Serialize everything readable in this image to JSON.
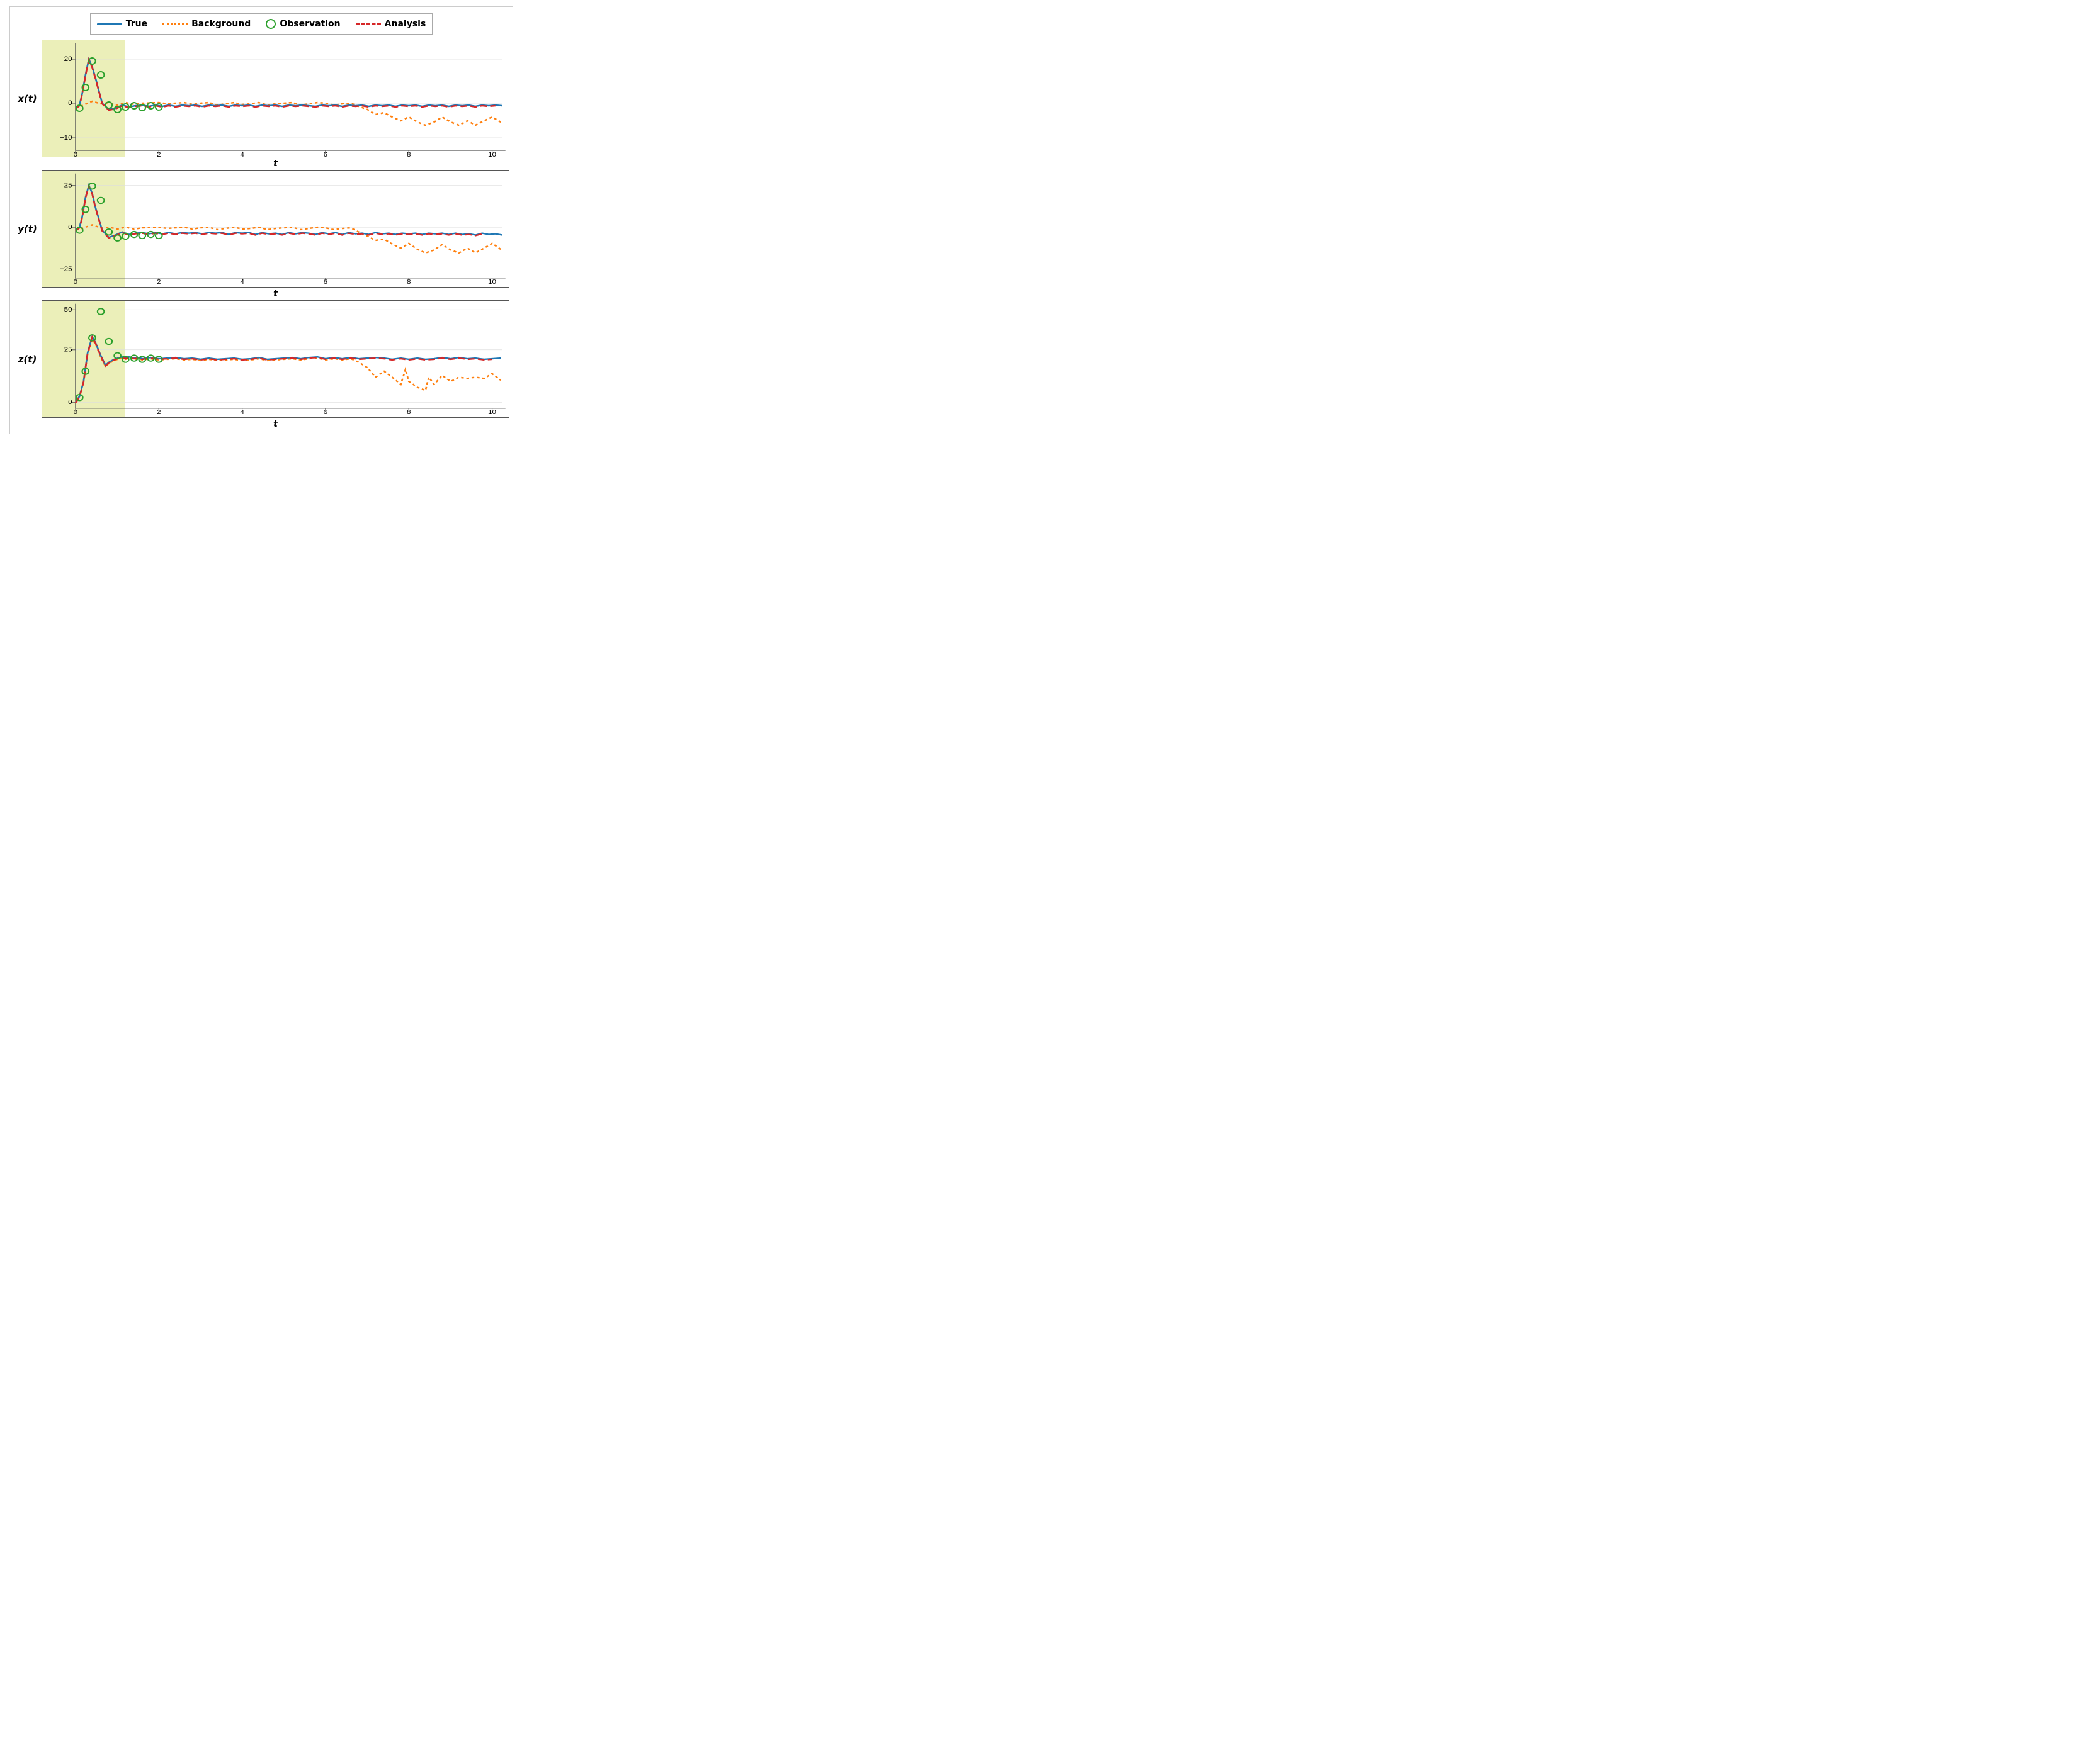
{
  "legend": {
    "items": [
      {
        "label": "True",
        "type": "solid-blue"
      },
      {
        "label": "Background",
        "type": "dotted-orange"
      },
      {
        "label": "Observation",
        "type": "circle-green"
      },
      {
        "label": "Analysis",
        "type": "dashed-red"
      }
    ]
  },
  "colors": {
    "blue": "#1f77b4",
    "orange": "#ff7f0e",
    "green": "#2ca02c",
    "red": "#d62728",
    "yellow_bg": "rgba(210,220,80,0.38)"
  },
  "plots": [
    {
      "id": "x",
      "ylabel": "x(t)",
      "yticks": [
        "20",
        "0",
        "-10"
      ],
      "yrange": [
        -12,
        22
      ],
      "xlabel": "t",
      "xticks": [
        "0",
        "2",
        "4",
        "6",
        "8",
        "10"
      ]
    },
    {
      "id": "y",
      "ylabel": "y(t)",
      "yticks": [
        "25",
        "0",
        "-25"
      ],
      "yrange": [
        -28,
        30
      ],
      "xlabel": "t",
      "xticks": [
        "0",
        "2",
        "4",
        "6",
        "8",
        "10"
      ]
    },
    {
      "id": "z",
      "ylabel": "z(t)",
      "yticks": [
        "50",
        "25",
        "0"
      ],
      "yrange": [
        -2,
        55
      ],
      "xlabel": "t",
      "xticks": [
        "0",
        "2",
        "4",
        "6",
        "8",
        "10"
      ]
    }
  ]
}
